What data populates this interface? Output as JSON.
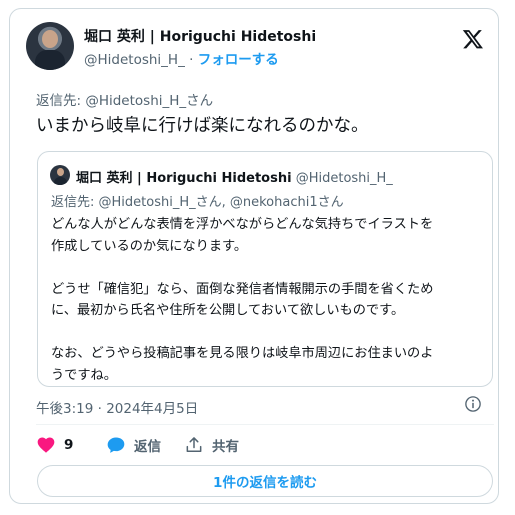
{
  "author": {
    "name": "堀口 英利 | Horiguchi Hidetoshi",
    "handle": "@Hidetoshi_H_",
    "separator": "·",
    "follow_label": "フォローする"
  },
  "reply_to": "返信先: @Hidetoshi_H_さん",
  "main_text": "いまから岐阜に行けば楽になれるのかな。",
  "quoted": {
    "name": "堀口 英利 | Horiguchi Hidetoshi",
    "handle": "@Hidetoshi_H_",
    "reply_to": "返信先: @Hidetoshi_H_さん, @nekohachi1さん",
    "paragraphs": [
      [
        "どんな人がどんな表情を浮かべながらどんな気持ちでイラストを",
        "作成しているのか気になります。"
      ],
      [
        "どうせ「確信犯」なら、面倒な発信者情報開示の手間を省くため",
        "に、最初から氏名や住所を公開しておいて欲しいものです。"
      ],
      [
        "なお、どうやら投稿記事を見る限りは岐阜市周辺にお住まいのよ",
        "うですね。"
      ]
    ]
  },
  "timestamp": "午後3:19 · 2024年4月5日",
  "actions": {
    "like_count": "9",
    "reply_label": "返信",
    "share_label": "共有"
  },
  "read_replies_label": "1件の返信を読む",
  "colors": {
    "accent": "#1d9bf0",
    "like": "#f91880",
    "muted": "#536471"
  },
  "icons": [
    "x-logo-icon",
    "heart-icon",
    "reply-bubble-icon",
    "share-icon",
    "info-icon"
  ]
}
